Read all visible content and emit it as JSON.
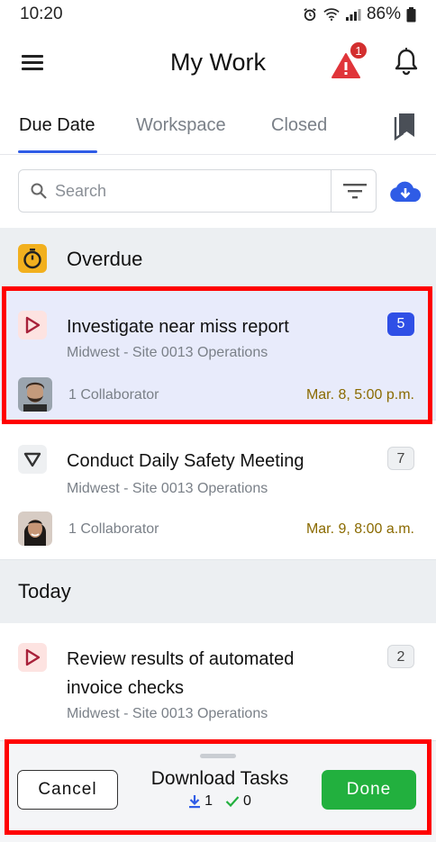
{
  "status_bar": {
    "time": "10:20",
    "battery": "86%"
  },
  "header": {
    "title": "My Work",
    "alert_count": "1"
  },
  "tabs": [
    {
      "label": "Due Date",
      "active": true
    },
    {
      "label": "Workspace",
      "active": false
    },
    {
      "label": "Closed",
      "active": false
    }
  ],
  "search": {
    "placeholder": "Search",
    "value": ""
  },
  "sections": [
    {
      "title": "Overdue",
      "icon": "timer-icon"
    },
    {
      "title": "Today"
    }
  ],
  "tasks": [
    {
      "title": "Investigate near miss report",
      "location": "Midwest - Site 0013 Operations",
      "count": "5",
      "collaborators": "1 Collaborator",
      "due": "Mar. 8, 5:00 p.m.",
      "icon": "play-triangle-icon",
      "selected": true
    },
    {
      "title": "Conduct Daily Safety Meeting",
      "location": "Midwest - Site 0013 Operations",
      "count": "7",
      "collaborators": "1 Collaborator",
      "due": "Mar. 9, 8:00 a.m.",
      "icon": "down-triangle-icon",
      "selected": false
    },
    {
      "title": "Review results of automated invoice checks",
      "location": "Midwest - Site 0013 Operations",
      "count": "2",
      "icon": "play-triangle-icon",
      "selected": false
    }
  ],
  "bottom_sheet": {
    "title": "Download Tasks",
    "cancel_label": "Cancel",
    "done_label": "Done",
    "download_count": "1",
    "done_count": "0"
  },
  "colors": {
    "accent": "#2f5ce6",
    "badge_red": "#d32f2f",
    "due_text": "#8a6a00",
    "done_green": "#22b03e",
    "overdue_icon": "#f2b01e",
    "annotation": "#ff0000"
  }
}
